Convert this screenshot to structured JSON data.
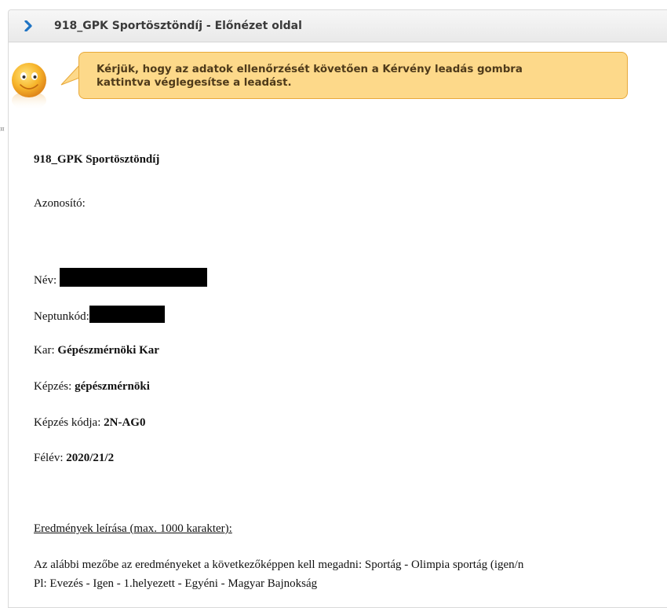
{
  "header": {
    "title": "918_GPK Sportösztöndíj - Előnézet oldal",
    "icon": "chevron-right-icon",
    "accent": "#1f74c4"
  },
  "notice": {
    "icon": "smiley-face-icon",
    "line1": "Kérjük, hogy az adatok ellenőrzését követően a Kérvény leadás gombra",
    "line2": "kattintva véglegesítse a leadást.",
    "bg_color": "#fdd98a",
    "border_color": "#e8a93a"
  },
  "form": {
    "title": "918_GPK Sportösztöndíj",
    "azonosito_label": "Azonosító:",
    "nev_label": "Név:",
    "neptun_label": "Neptunkód:",
    "kar_label": "Kar:",
    "kar_value": "Gépészmérnöki Kar",
    "kepzes_label": "Képzés:",
    "kepzes_value": "gépészmérnöki",
    "kepzes_kod_label": "Képzés kódja:",
    "kepzes_kod_value": "2N-AG0",
    "felev_label": "Félév:",
    "felev_value": "2020/21/2",
    "eredmenyek_label": "Eredmények leírása (max. 1000 karakter):",
    "instruction_line1": "Az alábbi mezőbe az eredményeket a következőképpen kell megadni: Sportág - Olimpia sportág (igen/n",
    "instruction_line2": "Pl: Evezés - Igen - 1.helyezett - Egyéni - Magyar Bajnokság"
  }
}
